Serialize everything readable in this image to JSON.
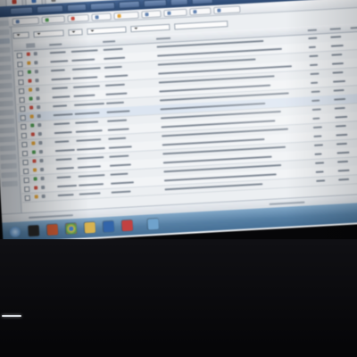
{
  "colors": {
    "header": "#2f4f7f",
    "taskbar": "#5d89b0",
    "selection": "#dde7f3",
    "flags": [
      "#d24a3c",
      "#e3a234",
      "#4a9a4e"
    ]
  },
  "taskbar_icons": [
    "start-orb",
    "console-icon",
    "media-icon",
    "chrome-icon",
    "explorer-icon",
    "outlook-icon",
    "paint-icon",
    "network-icon"
  ]
}
